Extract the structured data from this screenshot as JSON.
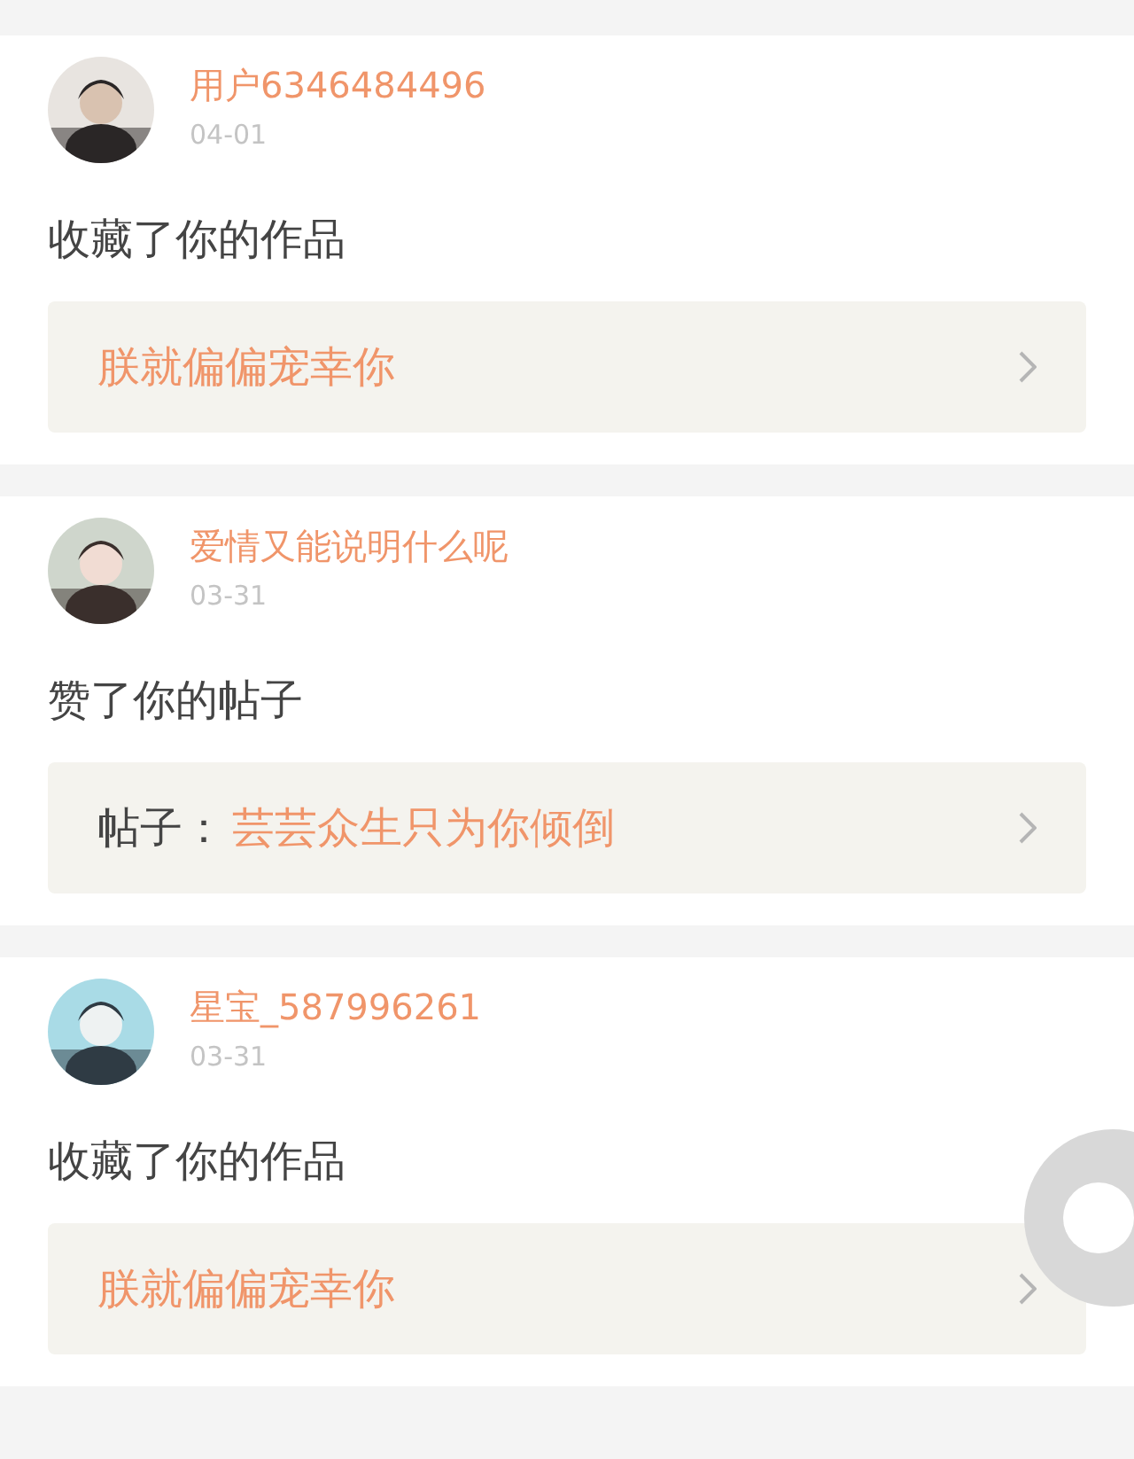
{
  "notifications": [
    {
      "user": "用户6346484496",
      "date": "04-01",
      "action": "收藏了你的作品",
      "link": {
        "kind": "work",
        "title": "朕就偏偏宠幸你"
      }
    },
    {
      "user": "爱情又能说明什么呢",
      "date": "03-31",
      "action": "赞了你的帖子",
      "link": {
        "kind": "post",
        "label": "帖子：",
        "title": "芸芸众生只为你倾倒"
      }
    },
    {
      "user": "星宝_587996261",
      "date": "03-31",
      "action": "收藏了你的作品",
      "link": {
        "kind": "work",
        "title": "朕就偏偏宠幸你"
      }
    }
  ]
}
